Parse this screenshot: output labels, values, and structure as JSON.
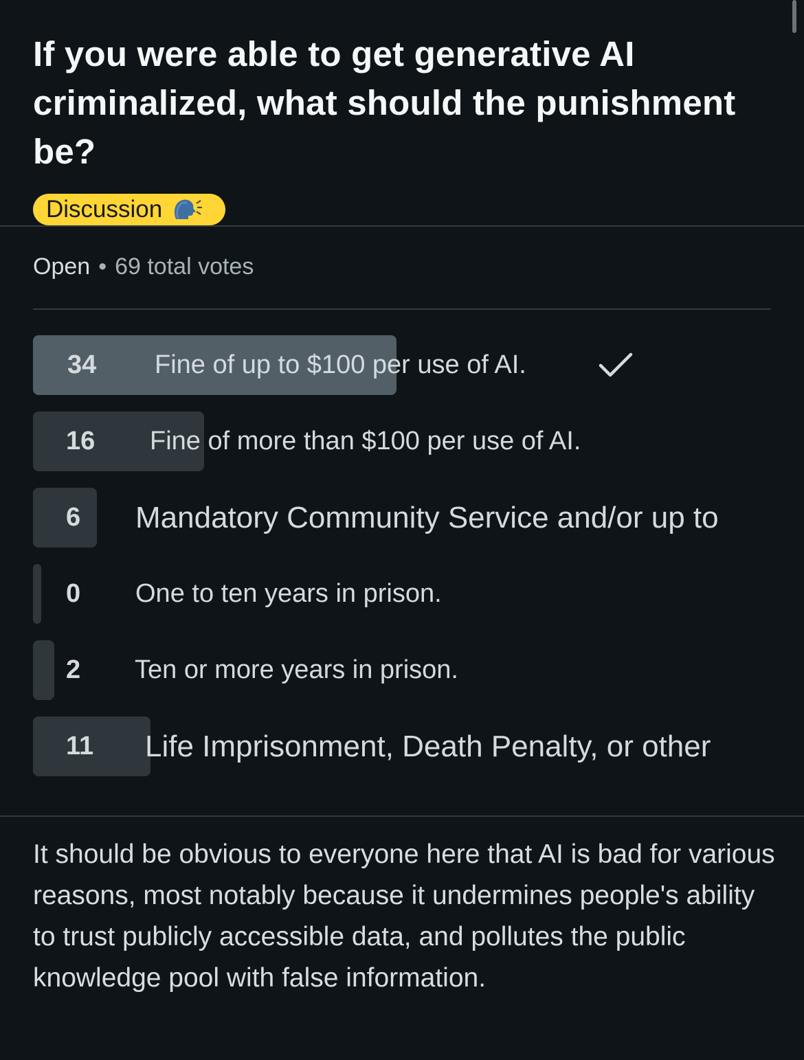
{
  "post": {
    "title": "If you were able to get generative AI criminalized, what should the punishment be?",
    "flair": {
      "label": "Discussion",
      "icon": "speaking-head-icon",
      "background_color": "#ffd635"
    },
    "body": "It should be obvious to everyone here that AI is bad for various reasons, most notably because it undermines people's ability to trust publicly accessible data, and pollutes the public knowledge pool with false information."
  },
  "poll": {
    "status": "Open",
    "separator": "•",
    "total_votes_text": "69 total votes",
    "total_votes": 69,
    "options": [
      {
        "count": "34",
        "label": "Fine of up to $100 per use of AI.",
        "share": 0.493,
        "selected": true
      },
      {
        "count": "16",
        "label": "Fine of more than $100 per use of AI.",
        "share": 0.232,
        "selected": false
      },
      {
        "count": "6",
        "label": "Mandatory Community Service and/or up to",
        "share": 0.087,
        "selected": false
      },
      {
        "count": "0",
        "label": "One to ten years in prison.",
        "share": 0.0,
        "selected": false
      },
      {
        "count": "2",
        "label": "Ten or more years in prison.",
        "share": 0.029,
        "selected": false
      },
      {
        "count": "11",
        "label": "Life Imprisonment, Death Penalty, or other",
        "share": 0.159,
        "selected": false
      }
    ],
    "selected_icon": "checkmark-icon",
    "colors": {
      "winner_bar": "#535f66",
      "bar": "#2f373d"
    }
  }
}
